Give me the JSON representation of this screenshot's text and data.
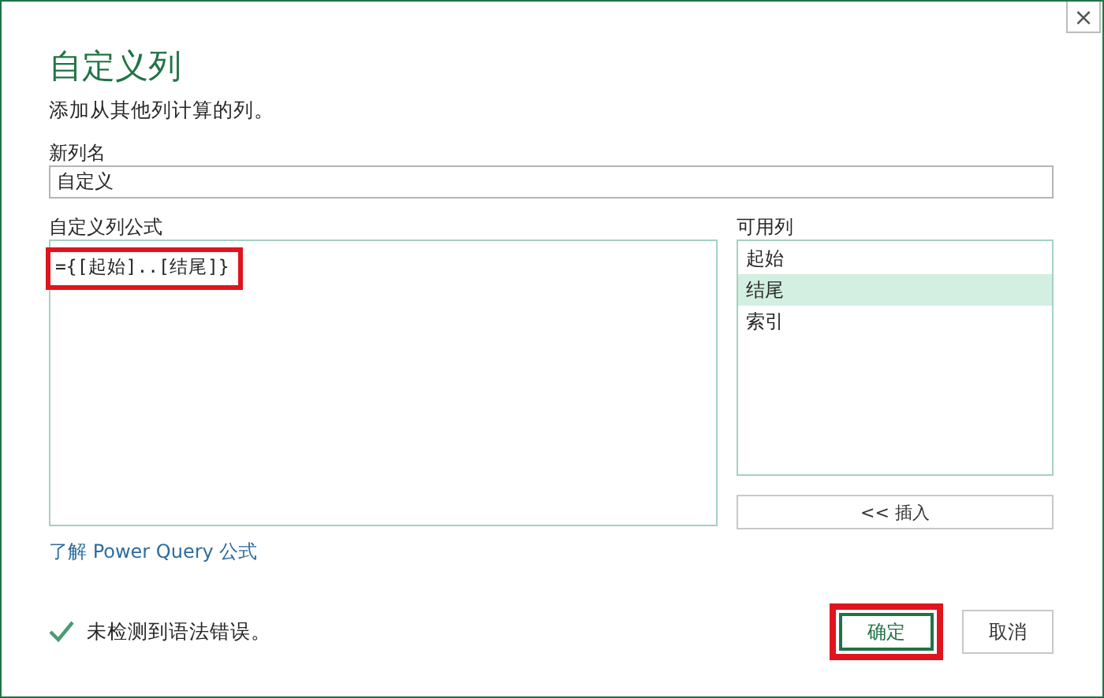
{
  "window": {
    "close": "×"
  },
  "title": "自定义列",
  "subtitle": "添加从其他列计算的列。",
  "new_column": {
    "label": "新列名",
    "value": "自定义"
  },
  "formula": {
    "label": "自定义列公式",
    "value": "={[起始]..[结尾]}",
    "highlighted": true
  },
  "available_columns": {
    "label": "可用列",
    "items": [
      {
        "label": "起始",
        "selected": false
      },
      {
        "label": "结尾",
        "selected": true
      },
      {
        "label": "索引",
        "selected": false
      }
    ],
    "insert_button": "<< 插入"
  },
  "link": "了解 Power Query 公式",
  "status": {
    "ok": true,
    "text": "未检测到语法错误。"
  },
  "buttons": [
    {
      "label": "确定",
      "kind": "primary",
      "highlighted": true
    },
    {
      "label": "取消",
      "kind": "secondary",
      "highlighted": false
    }
  ]
}
